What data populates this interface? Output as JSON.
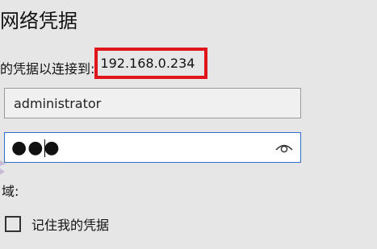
{
  "dialog": {
    "title": "网络凭据",
    "prompt_prefix": "的凭据以连接到:",
    "host": "192.168.0.234"
  },
  "username": {
    "value": "administrator"
  },
  "password": {
    "masked_value": "●●●",
    "reveal_icon": "eye-icon"
  },
  "domain": {
    "label": "域:"
  },
  "remember": {
    "label": "记住我的凭据",
    "checked": false
  },
  "colors": {
    "background": "#e6e6e6",
    "highlight": "#e0141b",
    "focus_border": "#2c6fc5"
  }
}
